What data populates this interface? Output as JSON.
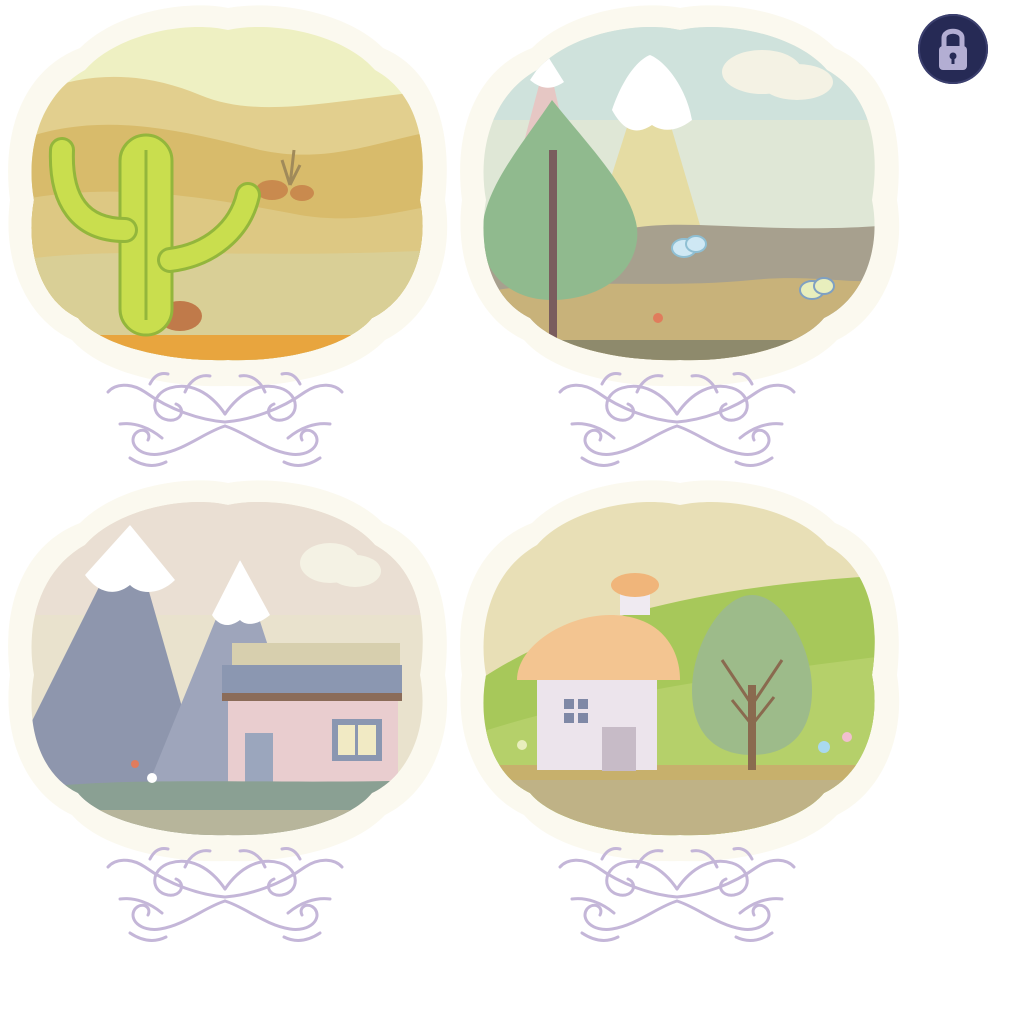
{
  "levels": [
    {
      "scene": "desert-cactus",
      "locked": false
    },
    {
      "scene": "forest-mountains",
      "locked": false
    },
    {
      "scene": "mountain-house",
      "locked": false
    },
    {
      "scene": "green-hills-cottage",
      "locked": false
    }
  ],
  "lock_button": {
    "icon": "padlock-icon"
  },
  "colors": {
    "frame": "#fbf9ef",
    "ornament": "#c4b6d8",
    "lock_bg": "#262a55",
    "lock_icon": "#b3aed3"
  }
}
